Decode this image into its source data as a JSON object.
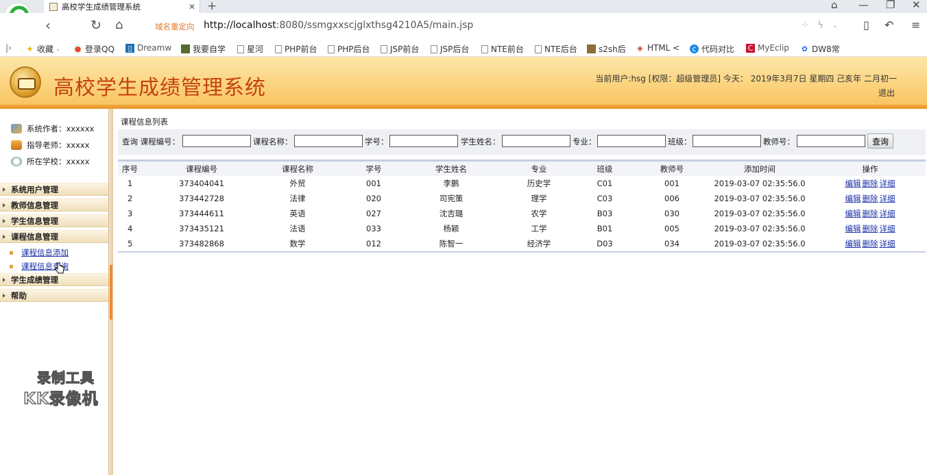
{
  "browser": {
    "tab_title": "高校学生成绩管理系统",
    "redirect_label": "域名重定向",
    "url_host": "http://localhost",
    "url_rest": ":8080/ssmgxxscjglxthsg4210A5/main.jsp",
    "bookmarks": [
      "收藏",
      "登录QQ",
      "Dreamw",
      "我要自学",
      "星河",
      "PHP前台",
      "PHP后台",
      "JSP前台",
      "JSP后台",
      "NTE前台",
      "NTE后台",
      "s2sh后",
      "HTML <",
      "代码对比",
      "MyEclip",
      "DW8常"
    ]
  },
  "header": {
    "title": "高校学生成绩管理系统",
    "user_info": "当前用户:hsg [权限：超级管理员] 今天： 2019年3月7日 星期四 己亥年 二月初一",
    "logout": "退出"
  },
  "sidebar": {
    "info": [
      "系统作者：xxxxxx",
      "指导老师：xxxxx",
      "所在学校：xxxxx"
    ],
    "menus": [
      "系统用户管理",
      "教师信息管理",
      "学生信息管理",
      "课程信息管理",
      "学生成绩管理",
      "帮助"
    ],
    "course_sub": [
      "课程信息添加",
      "课程信息查询"
    ],
    "watermark": [
      "录制工具",
      "KK录像机"
    ]
  },
  "main": {
    "section_title": "课程信息列表",
    "search": {
      "query_label": "查询",
      "fields": [
        "课程编号：",
        "课程名称：",
        "学号：",
        "学生姓名：",
        "专业：",
        "班级：",
        "教师号："
      ],
      "button": "查询"
    },
    "columns": [
      "序号",
      "课程编号",
      "课程名称",
      "学号",
      "学生姓名",
      "专业",
      "班级",
      "教师号",
      "添加时间",
      "操作"
    ],
    "ops": [
      "编辑",
      "删除",
      "详细"
    ],
    "rows": [
      [
        "1",
        "373404041",
        "外贸",
        "001",
        "李鹏",
        "历史学",
        "C01",
        "001",
        "2019-03-07 02:35:56.0"
      ],
      [
        "2",
        "373442728",
        "法律",
        "020",
        "司宪策",
        "理学",
        "C03",
        "006",
        "2019-03-07 02:35:56.0"
      ],
      [
        "3",
        "373444611",
        "英语",
        "027",
        "沈吉璐",
        "农学",
        "B03",
        "030",
        "2019-03-07 02:35:56.0"
      ],
      [
        "4",
        "373435121",
        "法语",
        "033",
        "杨颖",
        "工学",
        "B01",
        "005",
        "2019-03-07 02:35:56.0"
      ],
      [
        "5",
        "373482868",
        "数学",
        "012",
        "陈智一",
        "经济学",
        "D03",
        "034",
        "2019-03-07 02:35:56.0"
      ]
    ]
  },
  "colors": {
    "title": "#c4420e",
    "link": "#1a2fa8",
    "header_bg": "#fbd17a",
    "redirect": "#e07a2a"
  }
}
